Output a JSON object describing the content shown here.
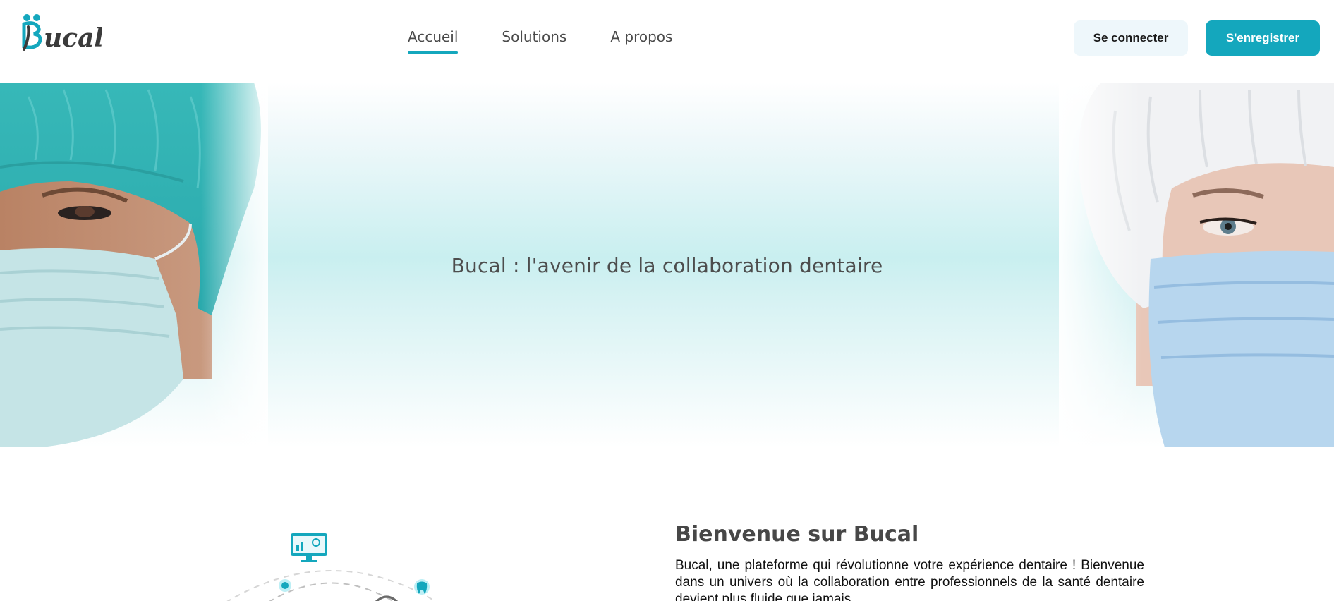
{
  "header": {
    "logo_text": "Bucal",
    "nav": [
      {
        "label": "Accueil",
        "active": true
      },
      {
        "label": "Solutions",
        "active": false
      },
      {
        "label": "A propos",
        "active": false
      }
    ],
    "login_label": "Se connecter",
    "register_label": "S'enregistrer"
  },
  "hero": {
    "title": "Bucal : l'avenir de la collaboration dentaire"
  },
  "welcome": {
    "title": "Bienvenue sur Bucal",
    "text": "Bucal, une plateforme qui révolutionne votre expérience dentaire ! Bienvenue dans un univers où la collaboration entre professionnels de la santé dentaire devient plus fluide que jamais."
  },
  "colors": {
    "accent": "#14a7bd",
    "login_bg": "#eef7fb",
    "text_dark": "#4a4a4a"
  },
  "icons": [
    "logo-icon",
    "monitor-dashboard-icon",
    "tooth-icon",
    "network-node-icon"
  ]
}
